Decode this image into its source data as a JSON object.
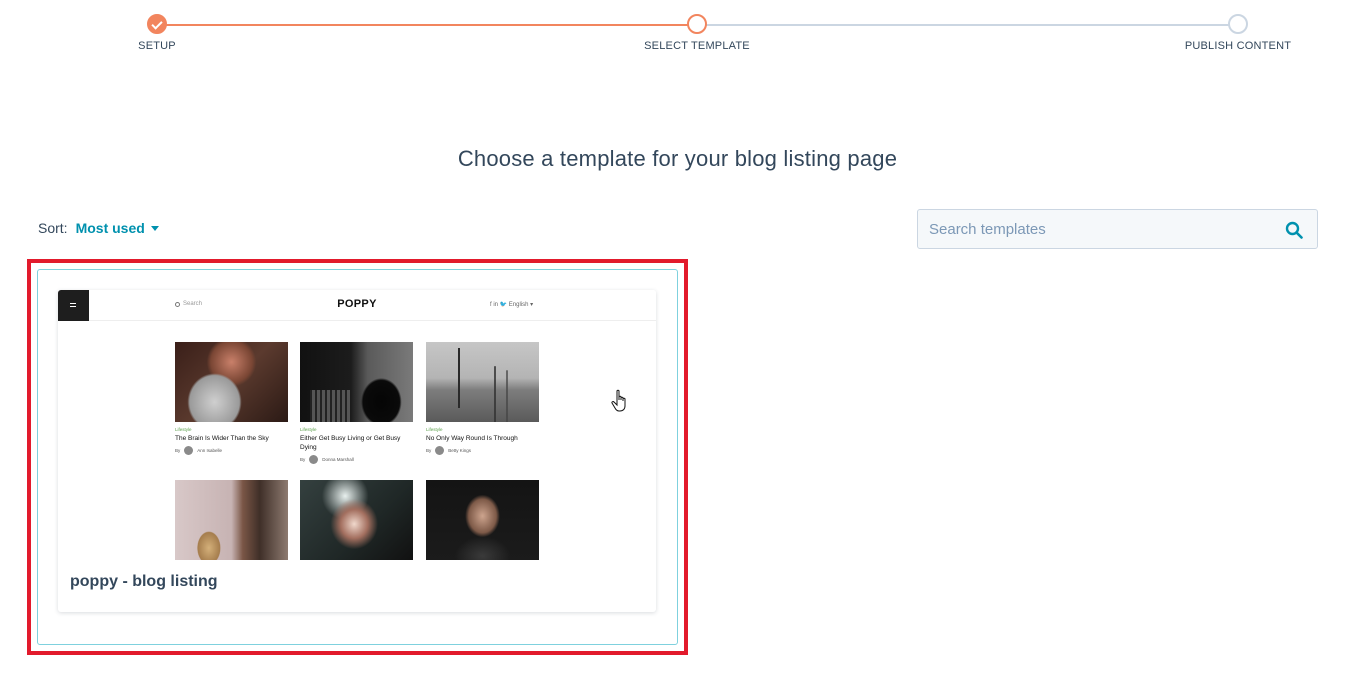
{
  "stepper": {
    "steps": [
      {
        "label": "SETUP",
        "state": "done"
      },
      {
        "label": "SELECT TEMPLATE",
        "state": "current"
      },
      {
        "label": "PUBLISH CONTENT",
        "state": "todo"
      }
    ],
    "colors": {
      "done": "#f2855e",
      "todo": "#cbd6e2"
    }
  },
  "main": {
    "title": "Choose a template for your blog listing page"
  },
  "sort": {
    "label": "Sort:",
    "value": "Most used"
  },
  "search": {
    "placeholder": "Search templates",
    "icon": "search-icon"
  },
  "templates": [
    {
      "name": "poppy - blog listing",
      "selected": true,
      "preview": {
        "logo": "POPPY",
        "search_text": "Search",
        "social_text": "f  in  🐦  English ▾",
        "posts": [
          {
            "category": "Lifestyle",
            "title": "The Brain Is Wider Than the Sky",
            "by": "By",
            "author": "Ann Isabelle"
          },
          {
            "category": "Lifestyle",
            "title": "Either Get Busy Living or Get Busy Dying",
            "by": "By",
            "author": "Donna Marshall"
          },
          {
            "category": "Lifestyle",
            "title": "No Only Way Round Is Through",
            "by": "By",
            "author": "Betty Kings"
          },
          {
            "category": "",
            "title": "",
            "by": "",
            "author": ""
          },
          {
            "category": "",
            "title": "",
            "by": "",
            "author": ""
          },
          {
            "category": "",
            "title": "",
            "by": "",
            "author": ""
          }
        ]
      }
    }
  ],
  "colors": {
    "accent": "#0091ae",
    "selection_border": "#e21a2c",
    "card_outline": "#7fd1de",
    "text": "#33475b"
  }
}
